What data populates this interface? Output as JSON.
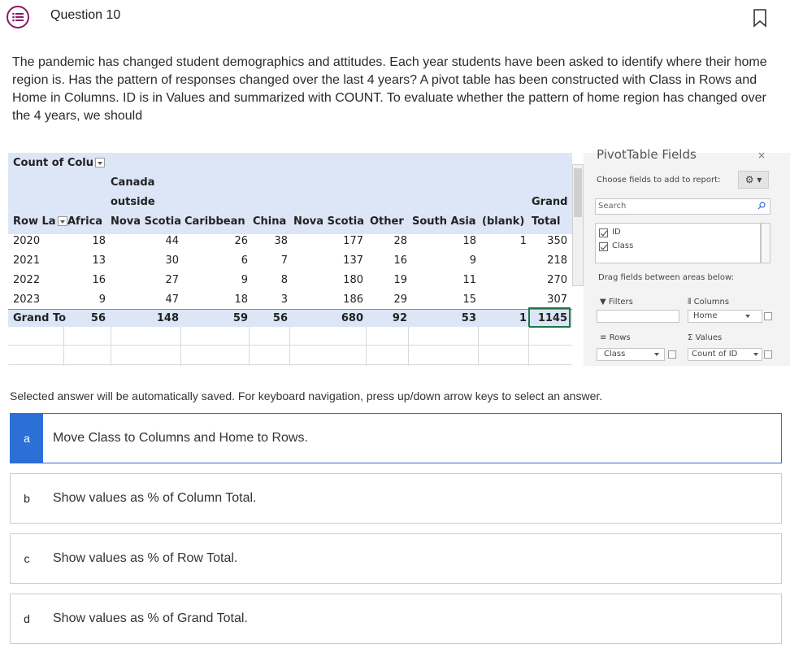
{
  "question": {
    "title": "Question 10",
    "text": "The pandemic has changed student demographics and attitudes.  Each year students have been asked to identify where their home region is.  Has the pattern of responses changed over the last 4 years? A pivot table has been constructed with Class in Rows and Home in Columns.  ID is in Values and summarized with COUNT.  To evaluate whether the pattern of home region has changed over the 4 years, we should"
  },
  "pivot": {
    "corner_label": "Count of Colu",
    "row_labels_header": "Row La",
    "col_header_line1": "Canada",
    "col_header_line2": "outside",
    "grand_line1": "Grand",
    "columns": [
      "Africa",
      "Nova Scotia",
      "Caribbean",
      "China",
      "Nova Scotia",
      "Other",
      "South Asia",
      "(blank)",
      "Total"
    ],
    "rows": [
      {
        "label": "2020",
        "values": [
          "18",
          "44",
          "26",
          "38",
          "177",
          "28",
          "18",
          "1",
          "350"
        ]
      },
      {
        "label": "2021",
        "values": [
          "13",
          "30",
          "6",
          "7",
          "137",
          "16",
          "9",
          "",
          "218"
        ]
      },
      {
        "label": "2022",
        "values": [
          "16",
          "27",
          "9",
          "8",
          "180",
          "19",
          "11",
          "",
          "270"
        ]
      },
      {
        "label": "2023",
        "values": [
          "9",
          "47",
          "18",
          "3",
          "186",
          "29",
          "15",
          "",
          "307"
        ]
      }
    ],
    "grand_total": {
      "label": "Grand To",
      "values": [
        "56",
        "148",
        "59",
        "56",
        "680",
        "92",
        "53",
        "1",
        "1145"
      ]
    }
  },
  "fields_pane": {
    "title": "PivotTable Fields",
    "close": "×",
    "choose_label": "Choose fields to add to report:",
    "search_placeholder": "Search",
    "fields": [
      {
        "name": "ID",
        "checked": true
      },
      {
        "name": "Class",
        "checked": true
      }
    ],
    "drag_label": "Drag fields between areas below:",
    "filters_label": "Filters",
    "columns_label": "Columns",
    "rows_label": "Rows",
    "values_label": "Values",
    "columns_item": "Home",
    "rows_item": "Class",
    "values_item": "Count of ID"
  },
  "instructions": "Selected answer will be automatically saved. For keyboard navigation, press up/down arrow keys to select an answer.",
  "options": [
    {
      "letter": "a",
      "text": "Move Class to Columns and Home to Rows.",
      "selected": true
    },
    {
      "letter": "b",
      "text": "Show values as % of Column Total.",
      "selected": false
    },
    {
      "letter": "c",
      "text": "Show values as % of Row Total.",
      "selected": false
    },
    {
      "letter": "d",
      "text": "Show values as % of Grand Total.",
      "selected": false
    }
  ],
  "colors": {
    "accent": "#2c6fd6",
    "pivot_header": "#dce6f6",
    "icon": "#8a1a6b"
  }
}
